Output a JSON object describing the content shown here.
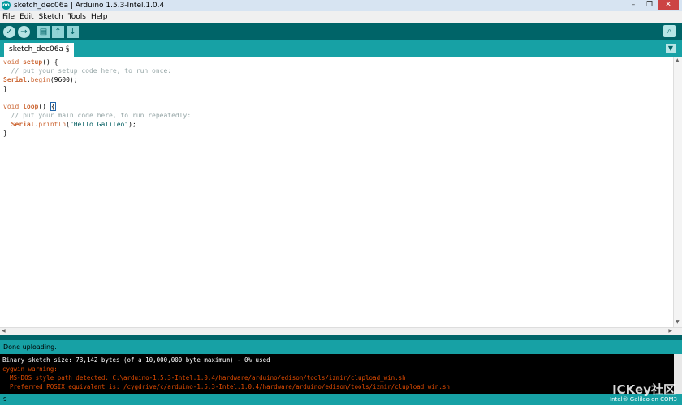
{
  "window": {
    "title": "sketch_dec06a | Arduino 1.5.3-Intel.1.0.4",
    "logo": "oo"
  },
  "menu": [
    "File",
    "Edit",
    "Sketch",
    "Tools",
    "Help"
  ],
  "toolbar": {
    "verify_icon": "✓",
    "upload_icon": "→",
    "new_icon": "▤",
    "open_icon": "↑",
    "save_icon": "↓",
    "serial_icon": "⌕"
  },
  "tab": {
    "name": "sketch_dec06a §",
    "menu_icon": "▼"
  },
  "code": {
    "l1_kw": "void",
    "l1_fn": "setup",
    "l1_rest": "() {",
    "l2": "  // put your setup code here, to run once:",
    "l3_cls": "Serial",
    "l3_dot": ".",
    "l3_fn": "begin",
    "l3_rest": "(9600);",
    "l4": "}",
    "l6_kw": "void",
    "l6_fn": "loop",
    "l6_rest": "() ",
    "l6_brace": "{",
    "l7": "  // put your main code here, to run repeatedly:",
    "l8_indent": "  ",
    "l8_cls": "Serial",
    "l8_dot": ".",
    "l8_fn": "println",
    "l8_open": "(",
    "l8_str": "\"Hello Galileo\"",
    "l8_close": ");",
    "l9": "}"
  },
  "status": {
    "message": "Done uploading."
  },
  "console": [
    {
      "text": "Binary sketch size: 73,142 bytes (of a 10,000,000 byte maximum) - 0% used",
      "kind": "normal"
    },
    {
      "text": "cygwin warning:",
      "kind": "err"
    },
    {
      "text": "  MS-DOS style path detected: C:\\arduino-1.5.3-Intel.1.0.4/hardware/arduino/edison/tools/izmir/clupload_win.sh",
      "kind": "err"
    },
    {
      "text": "  Preferred POSIX equivalent is: /cygdrive/c/arduino-1.5.3-Intel.1.0.4/hardware/arduino/edison/tools/izmir/clupload_win.sh",
      "kind": "err"
    }
  ],
  "footer": {
    "line_number": "9",
    "board": "Intel® Galileo on COM3"
  },
  "watermark": "ICKey社区",
  "colors": {
    "toolbar": "#006468",
    "tabbar": "#17a1a5",
    "error": "#e34c00"
  }
}
